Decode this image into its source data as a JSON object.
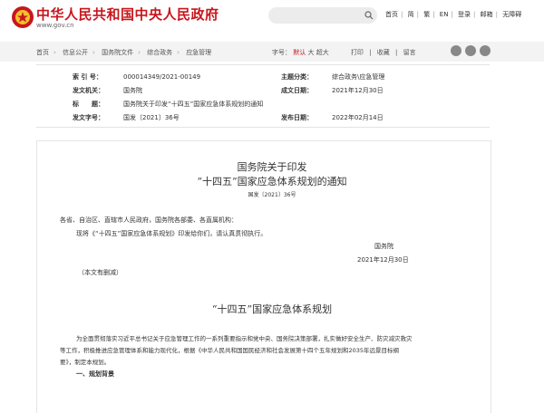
{
  "header": {
    "site_title": "中华人民共和国中央人民政府",
    "site_url": "www.gov.cn",
    "links": [
      "首页",
      "简",
      "繁",
      "EN",
      "登录",
      "邮箱",
      "无障碍"
    ]
  },
  "breadcrumb": [
    "首页",
    "信息公开",
    "国务院文件",
    "综合政务",
    "应急管理"
  ],
  "tools": {
    "font_label": "字号：",
    "font_default": "默认",
    "font_big": "大",
    "font_bigger": "超大",
    "print": "打印",
    "favorite": "收藏",
    "comment": "留言"
  },
  "meta": {
    "index_label": "索 引 号：",
    "index_value": "000014349/2021-00149",
    "topic_label": "主题分类：",
    "topic_value": "综合政务\\应急管理",
    "issuer_label": "发文机关：",
    "issuer_value": "国务院",
    "date_label": "成文日期：",
    "date_value": "2021年12月30日",
    "title_label": "标　　题：",
    "title_value": "国务院关于印发“十四五”国家应急体系规划的通知",
    "number_label": "发文字号：",
    "number_value": "国发〔2021〕36号",
    "publish_label": "发布日期：",
    "publish_value": "2022年02月14日"
  },
  "doc": {
    "heading1": "国务院关于印发",
    "heading2": "“十四五”国家应急体系规划的通知",
    "doc_number": "国发〔2021〕36号",
    "recipients": "各省、自治区、直辖市人民政府，国务院各部委、各直属机构：",
    "notice": "现将《“十四五”国家应急体系规划》印发给你们，请认真贯彻执行。",
    "signature": "国务院",
    "sign_date": "2021年12月30日",
    "note": "（本文有删减）",
    "plan_title": "“十四五”国家应急体系规划",
    "para1_l1": "为全面贯彻落实习近平总书记关于应急管理工作的一系列重要指示和党中央、国务院决策部署，扎实做好安全生产、防灾减灾救灾",
    "para1_l2": "等工作，积极推进应急管理体系和能力现代化，根据《中华人民共和国国民经济和社会发展第十四个五年规划和2035年远景目标纲",
    "para1_l3": "要》，制定本规划。",
    "section1": "一、规划背景"
  },
  "colors": {
    "brand_red": "#c8161d"
  },
  "icons": [
    "emblem-icon",
    "search-icon",
    "print-icon",
    "favorite-icon",
    "comment-icon",
    "wechat-icon",
    "weibo-icon",
    "qzone-icon"
  ]
}
